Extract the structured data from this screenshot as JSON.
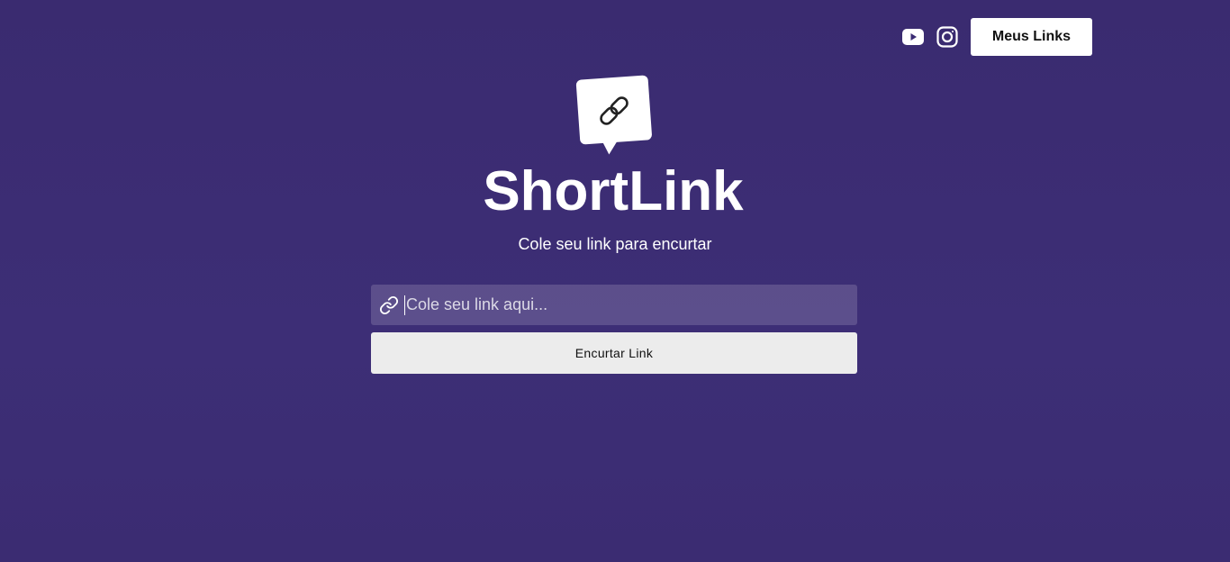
{
  "header": {
    "youtube_icon": "youtube-icon",
    "instagram_icon": "instagram-icon",
    "my_links_label": "Meus Links"
  },
  "hero": {
    "logo_icon": "chain-link-icon",
    "title": "ShortLink",
    "subtitle": "Cole seu link para encurtar"
  },
  "form": {
    "link_icon": "link-icon",
    "input_value": "",
    "input_placeholder": "Cole seu link aqui...",
    "submit_label": "Encurtar Link"
  },
  "colors": {
    "background": "#3b2c73",
    "button": "#ececec",
    "text": "#ffffff"
  }
}
